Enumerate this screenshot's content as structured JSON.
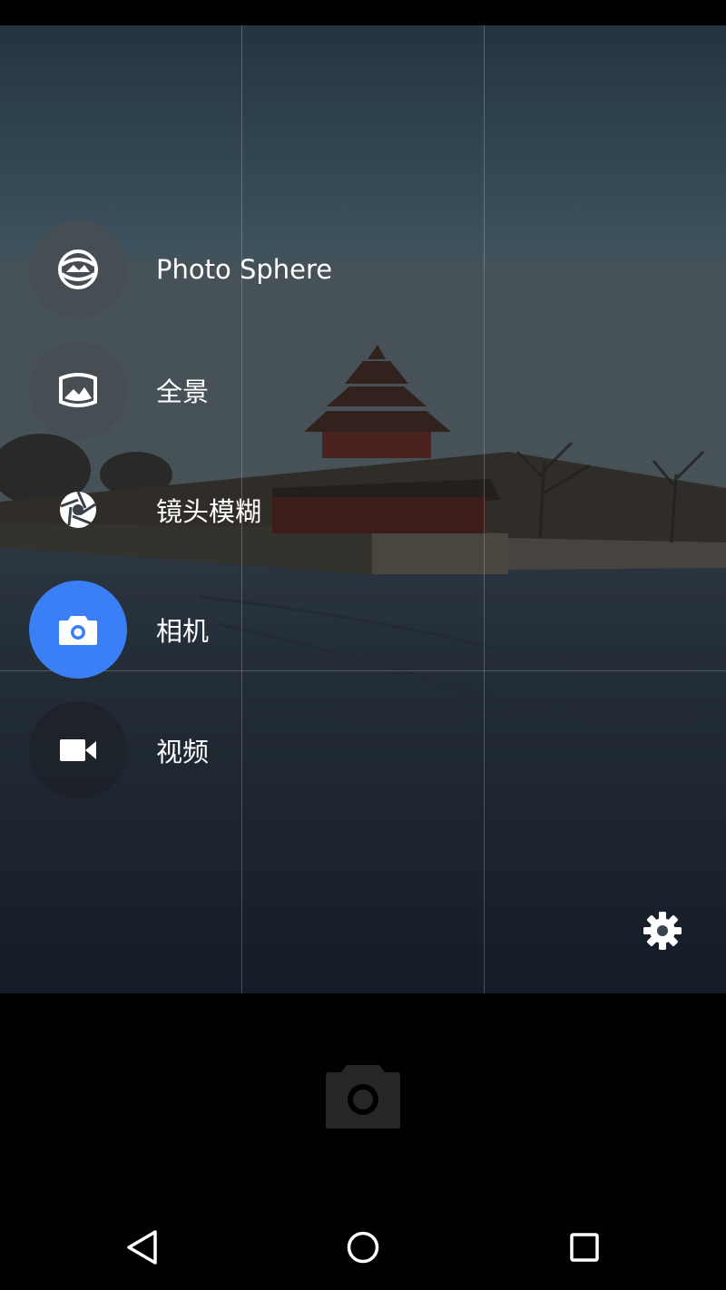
{
  "modes": [
    {
      "key": "photo_sphere",
      "label": "Photo Sphere",
      "icon": "photo-sphere-icon",
      "active": false
    },
    {
      "key": "panorama",
      "label": "全景",
      "icon": "panorama-icon",
      "active": false
    },
    {
      "key": "lens_blur",
      "label": "镜头模糊",
      "icon": "aperture-icon",
      "active": false
    },
    {
      "key": "camera",
      "label": "相机",
      "icon": "camera-icon",
      "active": true
    },
    {
      "key": "video",
      "label": "视频",
      "icon": "video-camera-icon",
      "active": false
    }
  ],
  "colors": {
    "accent": "#3a7ff6",
    "mode_circle": "#464e54",
    "background": "#000000"
  },
  "icons": {
    "settings": "gear-icon",
    "shutter": "camera-shutter-icon",
    "nav_back": "back-triangle-icon",
    "nav_home": "home-circle-icon",
    "nav_recents": "recents-square-icon"
  }
}
